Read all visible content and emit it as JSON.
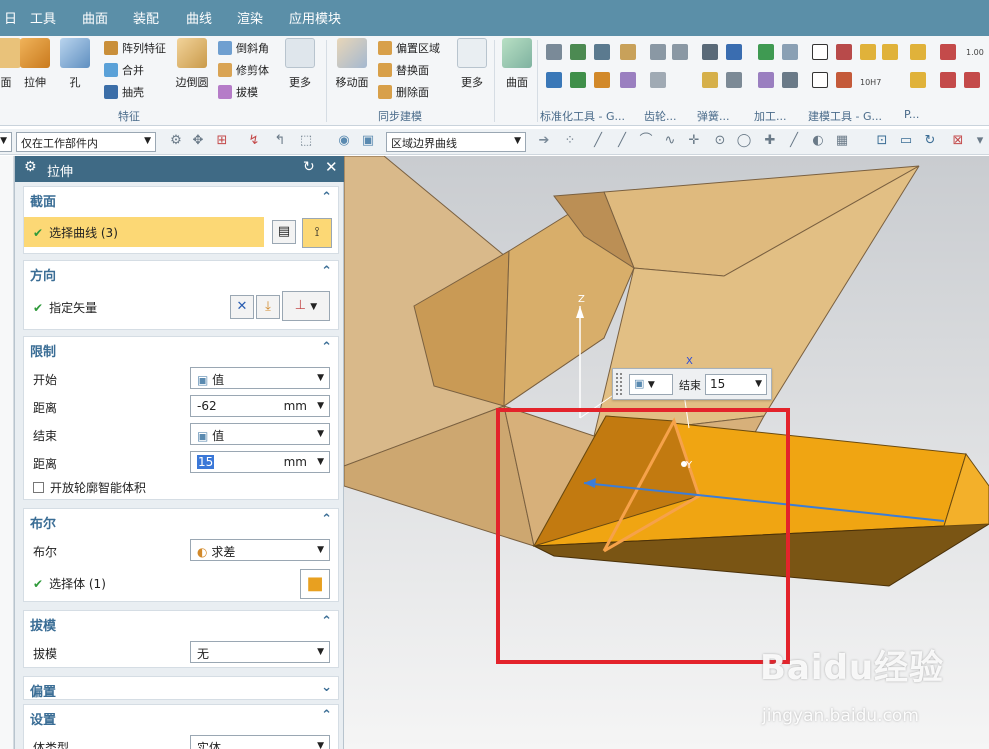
{
  "menu": {
    "items": [
      "工具",
      "曲面",
      "装配",
      "曲线",
      "渲染",
      "应用模块"
    ],
    "partial_left": "日"
  },
  "ribbon": {
    "big_buttons": {
      "face": "面",
      "extrude": "拉伸",
      "hole": "孔",
      "edge_blend": "边倒圆",
      "more1": "更多",
      "move_face": "移动面",
      "more2": "更多",
      "surface": "曲面"
    },
    "small_buttons": {
      "pattern_feature": "阵列特征",
      "unite": "合并",
      "shell": "抽壳",
      "chamfer": "倒斜角",
      "trim_body": "修剪体",
      "draft": "拔模",
      "offset_region": "偏置区域",
      "replace_face": "替换面",
      "delete_face": "删除面"
    },
    "groups": {
      "feature": "特征",
      "sync_modeling": "同步建模",
      "std_tools": "标准化工具 - G...",
      "gear": "齿轮...",
      "spring": "弹簧...",
      "machining": "加工...",
      "modeling_tools": "建模工具 - G...",
      "more": "P..."
    },
    "small_number": "1.00",
    "tol_label": "10H7"
  },
  "toolbar2": {
    "filter_scope": "仅在工作部件内",
    "curve_rule": "区域边界曲线"
  },
  "dialog": {
    "title": "拉伸",
    "sections": {
      "section": {
        "title": "截面",
        "select_curve": "选择曲线 (3)"
      },
      "direction": {
        "title": "方向",
        "specify_vector": "指定矢量"
      },
      "limits": {
        "title": "限制",
        "start_label": "开始",
        "start_value": "值",
        "distance1_label": "距离",
        "distance1_value": "-62",
        "end_label": "结束",
        "end_value": "值",
        "distance2_label": "距离",
        "distance2_value": "15",
        "unit": "mm",
        "open_profile": "开放轮廓智能体积"
      },
      "boolean": {
        "title": "布尔",
        "boolean_label": "布尔",
        "boolean_value": "求差",
        "select_body": "选择体 (1)"
      },
      "draft": {
        "title": "拔模",
        "draft_label": "拔模",
        "draft_value": "无"
      },
      "offset": {
        "title": "偏置"
      },
      "settings": {
        "title": "设置",
        "body_type_label": "体类型",
        "body_type_value": "实体"
      }
    }
  },
  "viewport": {
    "floating_end_label": "结束",
    "floating_end_value": "15",
    "axis_z": "Z",
    "axis_x": "X",
    "axis_y": "Y",
    "watermark": "Baidu经验",
    "watermark_url": "jingyan.baidu.com"
  }
}
